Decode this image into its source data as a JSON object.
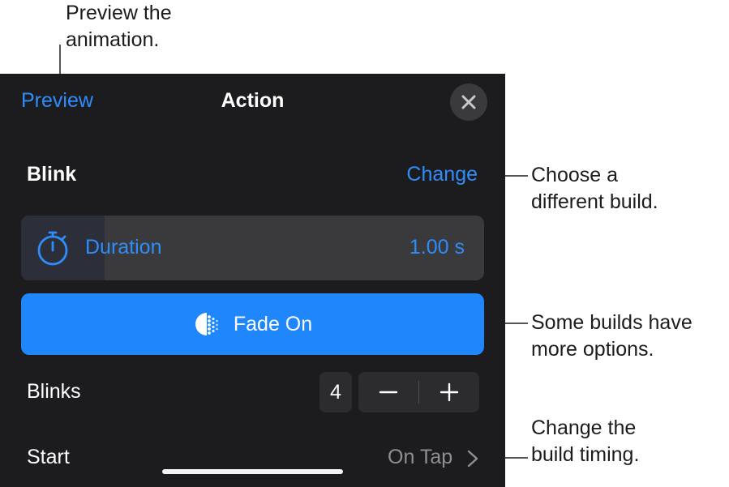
{
  "callouts": {
    "preview": "Preview the\nanimation.",
    "change": "Choose a\ndifferent build.",
    "options": "Some builds have\nmore options.",
    "timing": "Change the\nbuild timing."
  },
  "header": {
    "preview_label": "Preview",
    "title": "Action",
    "close_icon": "xmark"
  },
  "build": {
    "name": "Blink",
    "change_label": "Change"
  },
  "duration": {
    "label": "Duration",
    "value": "1.00 s",
    "fill_fraction": 0.18,
    "icon": "stopwatch-icon"
  },
  "fade_button": {
    "label": "Fade On",
    "icon": "fade-dots-icon"
  },
  "blinks": {
    "label": "Blinks",
    "count": "4",
    "decrement_icon": "minus",
    "increment_icon": "plus"
  },
  "start": {
    "label": "Start",
    "value": "On Tap",
    "icon": "chevron-right"
  },
  "colors": {
    "accent": "#2f8dfb",
    "button": "#1f86fb",
    "panel": "#1c1c1e"
  }
}
